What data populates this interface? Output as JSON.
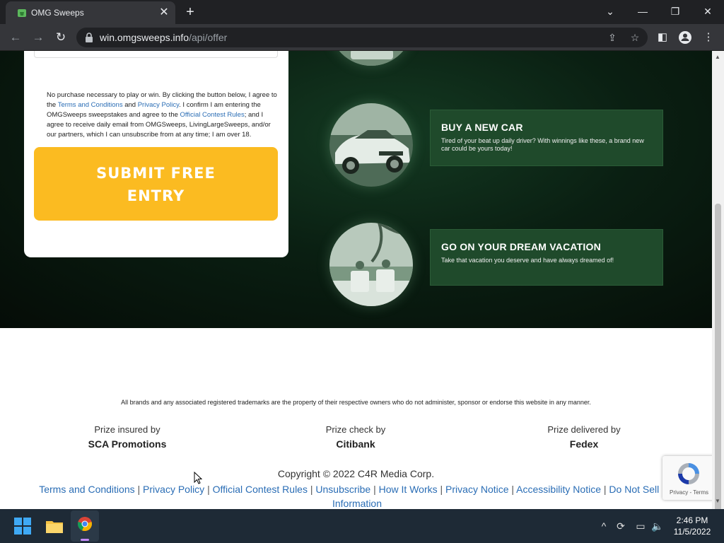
{
  "browser": {
    "tab_title": "OMG Sweeps",
    "tab_close": "✕",
    "new_tab": "+",
    "url_host": "win.omgsweeps.info",
    "url_path": "/api/offer",
    "window_controls": {
      "chevron": "⌄",
      "minimize": "—",
      "restore": "❐",
      "close": "✕"
    }
  },
  "form": {
    "legal_1": "No purchase necessary to play or win. By clicking the button below, I agree to the ",
    "terms_link": "Terms and Conditions",
    "legal_and": " and ",
    "privacy_link": "Privacy Policy",
    "legal_2": ". I confirm I am entering the OMGSweeps sweepstakes and agree to the ",
    "rules_link": "Official Contest Rules",
    "legal_3": "; and I agree to receive daily email from OMGSweeps, LivingLargeSweeps, and/or our partners, which I can unsubscribe from at any time; I am over 18.",
    "submit_label": "SUBMIT FREE ENTRY"
  },
  "benefits": [
    {
      "title": "BUY A NEW CAR",
      "desc": "Tired of your beat up daily driver? With winnings like these, a brand new car could be yours today!"
    },
    {
      "title": "GO ON YOUR DREAM VACATION",
      "desc": "Take that vacation you deserve and have always dreamed of!"
    }
  ],
  "footer": {
    "disclaimer": "All brands and any associated registered trademarks are the property of their respective owners who do not administer, sponsor or endorse this website in any manner.",
    "prizes": [
      {
        "label": "Prize insured by",
        "value": "SCA Promotions"
      },
      {
        "label": "Prize check by",
        "value": "Citibank"
      },
      {
        "label": "Prize delivered by",
        "value": "Fedex"
      }
    ],
    "copyright": "Copyright © 2022 C4R Media Corp.",
    "links": [
      "Terms and Conditions",
      "Privacy Policy",
      "Official Contest Rules",
      "Unsubscribe",
      "How It Works",
      "Privacy Notice",
      "Accessibility Notice",
      "Do Not Sell My Information"
    ],
    "separator": " | "
  },
  "recaptcha": {
    "text": "Privacy - Terms"
  },
  "taskbar": {
    "time": "2:46 PM",
    "date": "11/5/2022"
  },
  "colors": {
    "accent": "#fbbb21",
    "link": "#2a6db5",
    "hero_dark": "#0a1f12",
    "benefit_box": "#1f4a2b"
  }
}
